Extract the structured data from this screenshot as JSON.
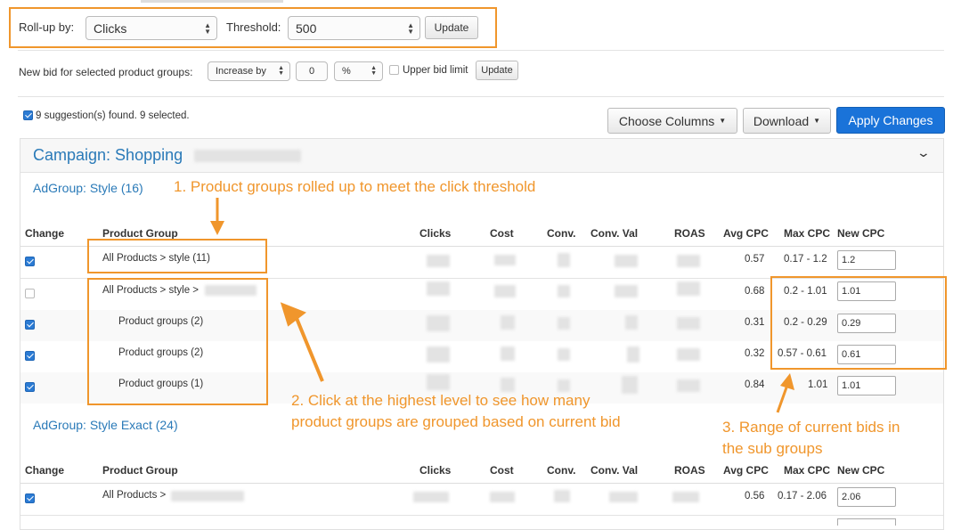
{
  "rollup": {
    "label": "Roll-up by:",
    "value": "Clicks",
    "threshold_label": "Threshold:",
    "threshold_value": "500",
    "update_label": "Update"
  },
  "newbid": {
    "label": "New bid for selected product groups:",
    "mode": "Increase by",
    "amount": "0",
    "unit": "%",
    "limit_label": "Upper bid limit",
    "update_label": "Update"
  },
  "suggestions": {
    "text": "9 suggestion(s) found. 9 selected."
  },
  "toolbar": {
    "choose_columns": "Choose Columns",
    "download": "Download",
    "apply": "Apply Changes"
  },
  "campaign": {
    "title": "Campaign: Shopping"
  },
  "columns": [
    "Change",
    "Product Group",
    "Clicks",
    "Cost",
    "Conv.",
    "Conv. Val",
    "ROAS",
    "Avg CPC",
    "Max CPC",
    "New CPC"
  ],
  "adgroup1": {
    "title": "AdGroup: Style (16)",
    "rows": [
      {
        "checked": true,
        "group": "All Products > style (11)",
        "avg_cpc": "0.57",
        "max_cpc": "0.17 - 1.2",
        "new_cpc": "1.2"
      },
      {
        "checked": false,
        "group": "All Products > style >",
        "avg_cpc": "0.68",
        "max_cpc": "0.2 - 1.01",
        "new_cpc": "1.01"
      },
      {
        "checked": true,
        "group": "Product groups (2)",
        "avg_cpc": "0.31",
        "max_cpc": "0.2 - 0.29",
        "new_cpc": "0.29"
      },
      {
        "checked": true,
        "group": "Product groups (2)",
        "avg_cpc": "0.32",
        "max_cpc": "0.57 - 0.61",
        "new_cpc": "0.61"
      },
      {
        "checked": true,
        "group": "Product groups (1)",
        "avg_cpc": "0.84",
        "max_cpc": "1.01",
        "new_cpc": "1.01"
      }
    ]
  },
  "adgroup2": {
    "title": "AdGroup: Style Exact (24)",
    "rows": [
      {
        "checked": true,
        "group": "All Products >",
        "avg_cpc": "0.56",
        "max_cpc": "0.17 - 2.06",
        "new_cpc": "2.06"
      }
    ]
  },
  "annotations": {
    "a1": "1. Product groups rolled up to meet the click threshold",
    "a2_line1": "2. Click at the highest level to see how many",
    "a2_line2": "product groups are grouped based on current bid",
    "a3_line1": "3. Range of current bids in",
    "a3_line2": "the sub groups"
  },
  "colors": {
    "accent": "#f0962c",
    "link": "#2a7ab8",
    "primary_button": "#1a73d9"
  }
}
